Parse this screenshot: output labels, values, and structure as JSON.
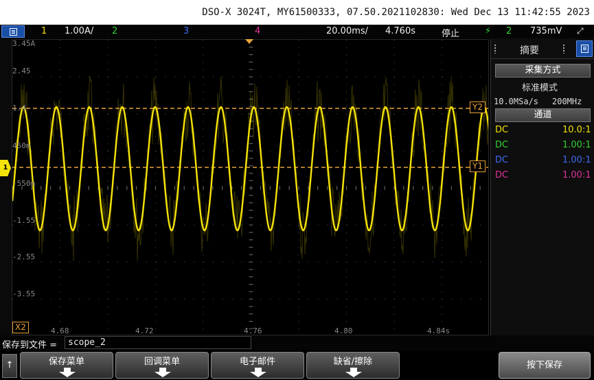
{
  "title_bar": {
    "text": "DSO-X 3024T, MY61500333, 07.50.2021102830: Wed Dec 13 11:42:55 2023"
  },
  "status_bar": {
    "ch1_label": "1",
    "ch1_scale": "1.00A/",
    "ch2_label": "2",
    "ch3_label": "3",
    "ch4_label": "4",
    "timebase": "20.00ms/",
    "delay": "4.760s",
    "run_state": "停止",
    "trigger_icon": "trigger-edge-icon",
    "trigger_channel": "2",
    "trigger_level": "735mV"
  },
  "y_scale": [
    "3.45A",
    "2.45",
    "1.4",
    "450m",
    "-550m",
    "-1.55",
    "-2.55",
    "-3.55"
  ],
  "x_scale": [
    "4.68",
    "4.72",
    "4.76",
    "4.80",
    "4.84s"
  ],
  "cursors": {
    "y2": "Y2",
    "y1": "Y1",
    "x2": "X2"
  },
  "ch1_marker": "1",
  "right_panel": {
    "title": "摘要",
    "acq_section": "采集方式",
    "acq_mode": "标准模式",
    "sample_rate": "10.0MSa/s",
    "bandwidth": "200MHz",
    "channel_section": "通道",
    "channels": [
      {
        "coupling": "DC",
        "ratio": "10.0:1",
        "color": "#f5e20a"
      },
      {
        "coupling": "DC",
        "ratio": "1.00:1",
        "color": "#32d232"
      },
      {
        "coupling": "DC",
        "ratio": "1.00:1",
        "color": "#3c6cf0"
      },
      {
        "coupling": "DC",
        "ratio": "1.00:1",
        "color": "#e0329a"
      }
    ]
  },
  "save_bar": {
    "label": "保存到文件 =",
    "filename": "scope_2"
  },
  "softkeys": {
    "up_key": "↑",
    "keys": [
      "保存菜单",
      "回调菜单",
      "电子邮件",
      "缺省/擦除"
    ],
    "press_save": "按下保存"
  },
  "colors": {
    "ch1": "#f5e20a",
    "ch2": "#32d232",
    "ch3": "#3c6cf0",
    "ch4": "#e0329a",
    "cursor": "#e8a33a",
    "accent_blue": "#1a4fa8"
  },
  "waveform": {
    "channel": "1",
    "cycles_visible": 14.5,
    "peak": 1.4,
    "trough": -1.55
  }
}
